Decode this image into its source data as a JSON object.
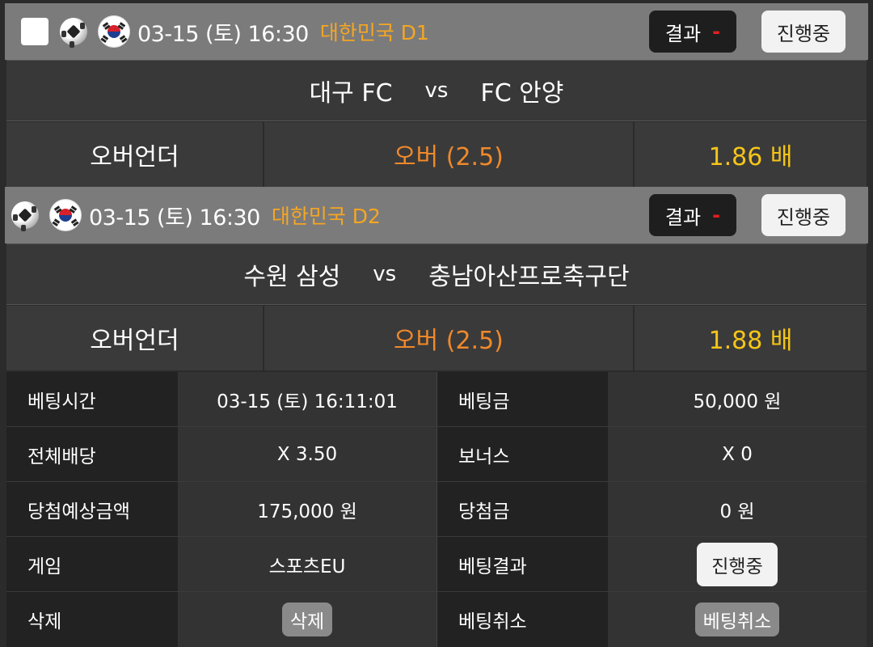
{
  "bets": [
    {
      "datetime": "03-15 (토) 16:30",
      "league": "대한민국 D1",
      "result_label": "결과",
      "result_value": "-",
      "status": "진행중",
      "home": "대구 FC",
      "vs": "vs",
      "away": "FC 안양",
      "market": "오버언더",
      "pick": "오버 (2.5)",
      "odds": "1.86 배"
    },
    {
      "datetime": "03-15 (토) 16:30",
      "league": "대한민국 D2",
      "result_label": "결과",
      "result_value": "-",
      "status": "진행중",
      "home": "수원 삼성",
      "vs": "vs",
      "away": "충남아산프로축구단",
      "market": "오버언더",
      "pick": "오버 (2.5)",
      "odds": "1.88 배"
    }
  ],
  "details": {
    "bet_time_label": "베팅시간",
    "bet_time": "03-15 (토) 16:11:01",
    "bet_amount_label": "베팅금",
    "bet_amount": "50,000 원",
    "total_odds_label": "전체배당",
    "total_odds": "X 3.50",
    "bonus_label": "보너스",
    "bonus": "X 0",
    "expected_win_label": "당첨예상금액",
    "expected_win": "175,000 원",
    "win_amount_label": "당첨금",
    "win_amount": "0 원",
    "game_label": "게임",
    "game": "스포츠EU",
    "bet_result_label": "베팅결과",
    "bet_result": "진행중",
    "delete_label": "삭제",
    "delete_button": "삭제",
    "cancel_label": "베팅취소",
    "cancel_button": "베팅취소"
  },
  "colors": {
    "league": "#f5a623",
    "pick": "#f0892a",
    "odds": "#f5c518",
    "result_dash": "#e02020"
  },
  "icons": {
    "sport": "soccer-ball-icon",
    "country": "korea-flag-icon"
  }
}
